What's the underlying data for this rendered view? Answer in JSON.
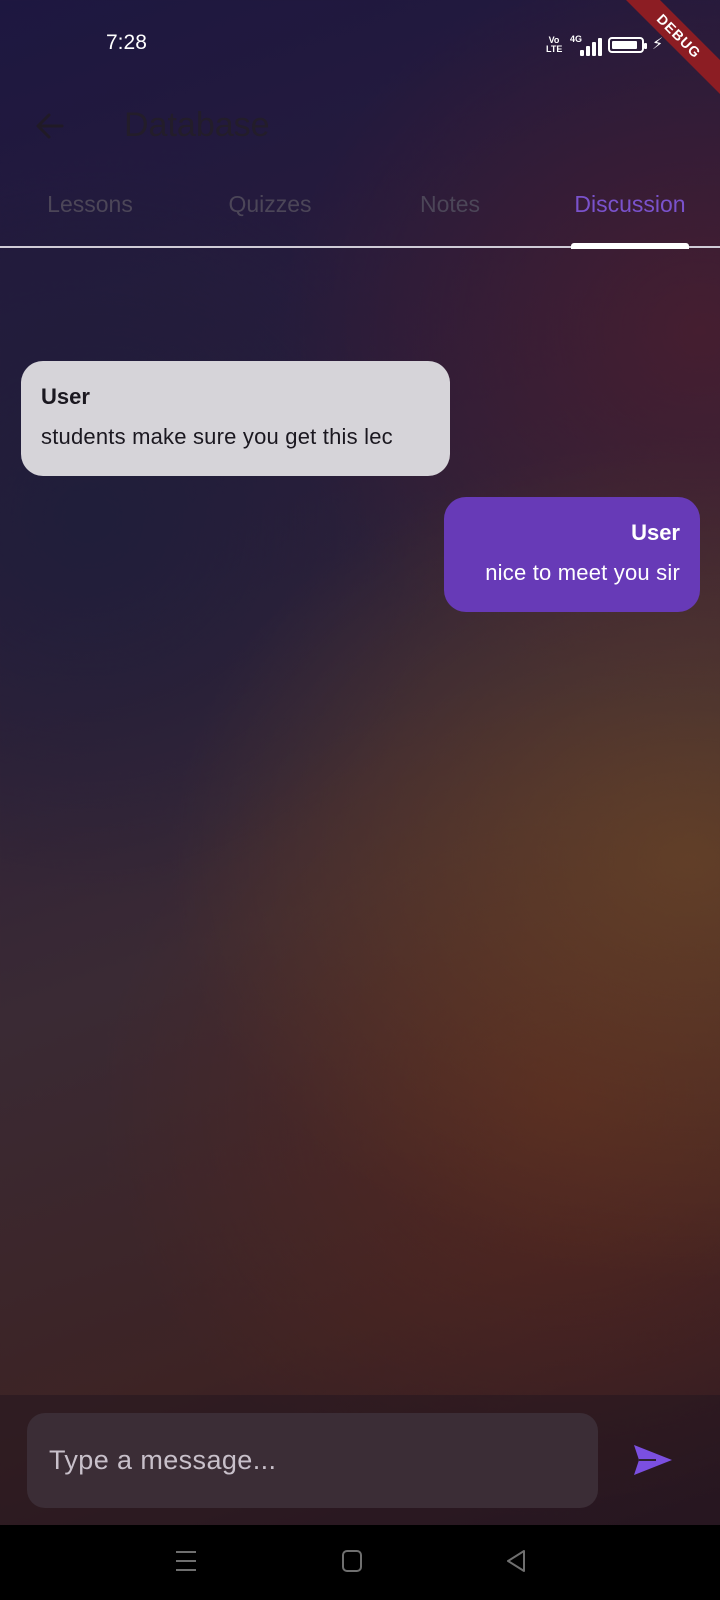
{
  "status_bar": {
    "time": "7:28",
    "volte": "Vo LTE",
    "network": "4G",
    "charging": true
  },
  "debug_banner": "DEBUG",
  "app_bar": {
    "title": "Database",
    "back_icon": "arrow-left-icon"
  },
  "tabs": [
    {
      "label": "Lessons",
      "active": false
    },
    {
      "label": "Quizzes",
      "active": false
    },
    {
      "label": "Notes",
      "active": false
    },
    {
      "label": "Discussion",
      "active": true
    }
  ],
  "messages": [
    {
      "sender": "User",
      "text": "students make sure you get this lec",
      "side": "left"
    },
    {
      "sender": "User",
      "text": "nice to meet you sir",
      "side": "right"
    }
  ],
  "composer": {
    "placeholder": "Type a message...",
    "value": "",
    "send_icon": "send-icon"
  },
  "colors": {
    "accent": "#673ab7",
    "tab_active": "#7a52cc",
    "send": "#7b4fe0",
    "incoming_bubble": "#d6d4d9",
    "debug_ribbon": "#8c1d23"
  },
  "nav_bar": {
    "icons": [
      "menu-icon",
      "home-square-icon",
      "back-triangle-icon"
    ]
  }
}
